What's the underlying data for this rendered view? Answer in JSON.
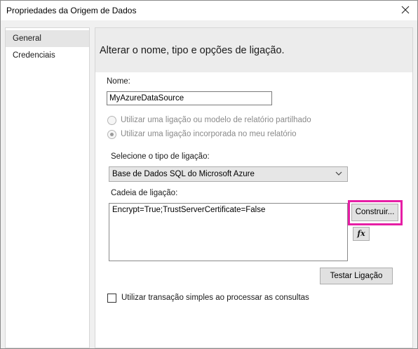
{
  "window": {
    "title": "Propriedades da Origem de Dados"
  },
  "sidebar": {
    "items": [
      {
        "label": "General",
        "selected": true
      },
      {
        "label": "Credenciais",
        "selected": false
      }
    ]
  },
  "content": {
    "header": "Alterar o nome, tipo e opções de ligação.",
    "name_label": "Nome:",
    "name_value": "MyAzureDataSource",
    "radio_shared": "Utilizar uma ligação ou modelo de relatório partilhado",
    "radio_embedded": "Utilizar uma ligação incorporada no meu relatório",
    "connection_type_label": "Selecione o tipo de ligação:",
    "connection_type_value": "Base de Dados SQL do Microsoft Azure",
    "connection_string_label": "Cadeia de ligação:",
    "connection_string_value": "Encrypt=True;TrustServerCertificate=False",
    "build_button": "Construir...",
    "fx_button": "fx",
    "test_button": "Testar Ligação",
    "single_transaction_label": "Utilizar transação simples ao processar as consultas"
  },
  "colors": {
    "highlight": "#e61ea5",
    "header_band": "#ececec",
    "sidebar_selected": "#e5e5e5"
  }
}
